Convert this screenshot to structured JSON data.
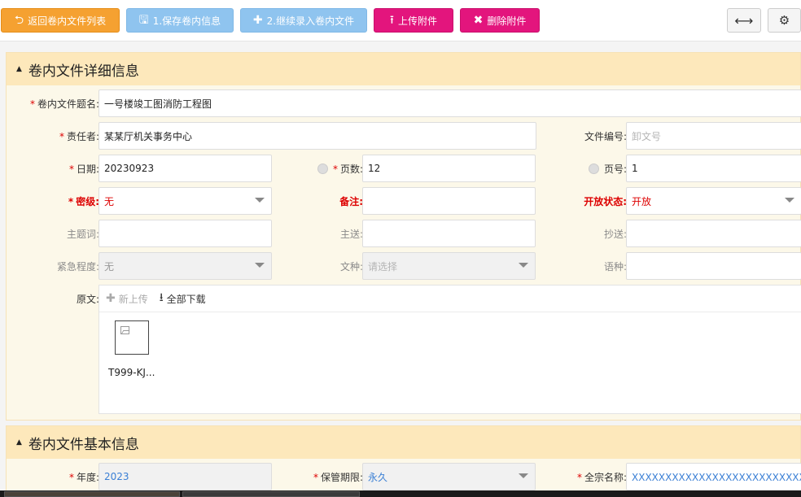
{
  "toolbar": {
    "back": "返回卷内文件列表",
    "save": "1.保存卷内信息",
    "continue": "2.继续录入卷内文件",
    "upload": "上传附件",
    "delete": "删除附件"
  },
  "detail": {
    "title": "卷内文件详细信息",
    "fields": {
      "title": {
        "label": "卷内文件题名:",
        "value": "一号楼竣工图消防工程图"
      },
      "responsible": {
        "label": "责任者:",
        "value": "某某厅机关事务中心"
      },
      "doc_no": {
        "label": "文件编号:",
        "placeholder": "卸文号"
      },
      "date": {
        "label": "日期:",
        "value": "20230923"
      },
      "page_count": {
        "label": "页数:",
        "value": "12"
      },
      "page_no": {
        "label": "页号:",
        "value": "1"
      },
      "secret": {
        "label": "密级:",
        "value": "无"
      },
      "remark": {
        "label": "备注:"
      },
      "open_status": {
        "label": "开放状态:",
        "value": "开放"
      },
      "keywords": {
        "label": "主题词:"
      },
      "send_to": {
        "label": "主送:"
      },
      "cc": {
        "label": "抄送:"
      },
      "urgency": {
        "label": "紧急程度:",
        "value": "无"
      },
      "doc_type": {
        "label": "文种:",
        "placeholder": "请选择"
      },
      "language": {
        "label": "语种:"
      },
      "original": {
        "label": "原文:"
      }
    },
    "original": {
      "new_upload": "新上传",
      "download_all": "全部下载",
      "file_name": "T999-KJ..."
    }
  },
  "basic": {
    "title": "卷内文件基本信息",
    "fields": {
      "year": {
        "label": "年度:",
        "value": "2023"
      },
      "retention": {
        "label": "保管期限:",
        "value": "永久"
      },
      "fonds": {
        "label": "全宗名称:",
        "value": "XXXXXXXXXXXXXXXXXXXXXXXXXXXXX厅"
      }
    }
  },
  "colors": {
    "back_button": "#f5a131",
    "save_button": "#8fc4ef",
    "danger_button": "#e3157d",
    "panel_header": "#fde8bb",
    "panel_body": "#fcf8e9",
    "required": "#dd0000",
    "link_value": "#3a7fd5"
  }
}
